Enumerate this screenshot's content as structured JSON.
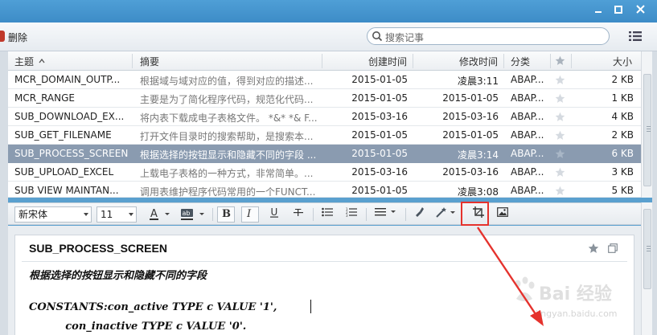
{
  "toolbar": {
    "delete_label": "删除",
    "search_placeholder": "搜索记事"
  },
  "list": {
    "columns": [
      "主题",
      "摘要",
      "创建时间",
      "修改时间",
      "分类",
      "大小"
    ],
    "rows": [
      {
        "subject": "MCR_DOMAIN_OUTP...",
        "summary": "根据域与域对应的值，得到对应的描述...",
        "created": "2015-01-05",
        "modified": "凌晨3:11",
        "category": "ABAP...",
        "size": "2 KB"
      },
      {
        "subject": "MCR_RANGE",
        "summary": "主要是为了简化程序代码，规范化代码...",
        "created": "2015-01-05",
        "modified": "2015-01-05",
        "category": "ABAP...",
        "size": "1 KB"
      },
      {
        "subject": "SUB_DOWNLOAD_EX...",
        "summary": "将内表下载成电子表格文件。 *&* *& F...",
        "created": "2015-03-16",
        "modified": "2015-03-16",
        "category": "ABAP...",
        "size": "4 KB"
      },
      {
        "subject": "SUB_GET_FILENAME",
        "summary": "打开文件目录时的搜索帮助，是搜索本...",
        "created": "2015-01-05",
        "modified": "2015-01-05",
        "category": "ABAP...",
        "size": "2 KB"
      },
      {
        "subject": "SUB_PROCESS_SCREEN",
        "summary": "根据选择的按钮显示和隐藏不同的字段 ...",
        "created": "2015-01-05",
        "modified": "凌晨3:14",
        "category": "ABAP...",
        "size": "6 KB"
      },
      {
        "subject": "SUB_UPLOAD_EXCEL",
        "summary": "上载电子表格的一种方式，非常简单。...",
        "created": "2015-03-16",
        "modified": "2015-03-16",
        "category": "ABAP...",
        "size": "3 KB"
      },
      {
        "subject": "SUB VIEW MAINTAN...",
        "summary": "调用表维护程序代码常用的一个FUNCT...",
        "created": "2015-01-05",
        "modified": "凌晨3:08",
        "category": "ABAP...",
        "size": "5 KB"
      }
    ],
    "selected_index": 4
  },
  "editor": {
    "font_name": "新宋体",
    "font_size": "11"
  },
  "note": {
    "title": "SUB_PROCESS_SCREEN",
    "lines": [
      "根据选择的按钮显示和隐藏不同的字段",
      "",
      "CONSTANTS:con_active TYPE c VALUE '1',",
      "          con_inactive TYPE c VALUE '0'."
    ]
  },
  "watermark": {
    "text": "Bai 经验",
    "sub": "jingyan.baidu.com"
  },
  "colors": {
    "titlebar": "#3d8cc7",
    "selected_row": "#8a9bb0",
    "highlight": "#e5322d"
  }
}
